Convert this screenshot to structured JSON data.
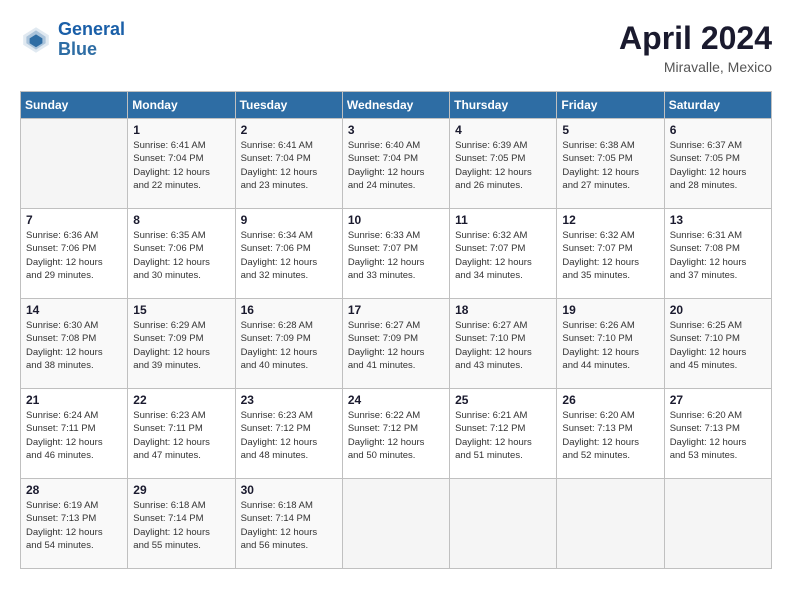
{
  "header": {
    "logo_line1": "General",
    "logo_line2": "Blue",
    "month_year": "April 2024",
    "location": "Miravalle, Mexico"
  },
  "days_of_week": [
    "Sunday",
    "Monday",
    "Tuesday",
    "Wednesday",
    "Thursday",
    "Friday",
    "Saturday"
  ],
  "weeks": [
    [
      {
        "day": "",
        "info": ""
      },
      {
        "day": "1",
        "info": "Sunrise: 6:41 AM\nSunset: 7:04 PM\nDaylight: 12 hours\nand 22 minutes."
      },
      {
        "day": "2",
        "info": "Sunrise: 6:41 AM\nSunset: 7:04 PM\nDaylight: 12 hours\nand 23 minutes."
      },
      {
        "day": "3",
        "info": "Sunrise: 6:40 AM\nSunset: 7:04 PM\nDaylight: 12 hours\nand 24 minutes."
      },
      {
        "day": "4",
        "info": "Sunrise: 6:39 AM\nSunset: 7:05 PM\nDaylight: 12 hours\nand 26 minutes."
      },
      {
        "day": "5",
        "info": "Sunrise: 6:38 AM\nSunset: 7:05 PM\nDaylight: 12 hours\nand 27 minutes."
      },
      {
        "day": "6",
        "info": "Sunrise: 6:37 AM\nSunset: 7:05 PM\nDaylight: 12 hours\nand 28 minutes."
      }
    ],
    [
      {
        "day": "7",
        "info": "Sunrise: 6:36 AM\nSunset: 7:06 PM\nDaylight: 12 hours\nand 29 minutes."
      },
      {
        "day": "8",
        "info": "Sunrise: 6:35 AM\nSunset: 7:06 PM\nDaylight: 12 hours\nand 30 minutes."
      },
      {
        "day": "9",
        "info": "Sunrise: 6:34 AM\nSunset: 7:06 PM\nDaylight: 12 hours\nand 32 minutes."
      },
      {
        "day": "10",
        "info": "Sunrise: 6:33 AM\nSunset: 7:07 PM\nDaylight: 12 hours\nand 33 minutes."
      },
      {
        "day": "11",
        "info": "Sunrise: 6:32 AM\nSunset: 7:07 PM\nDaylight: 12 hours\nand 34 minutes."
      },
      {
        "day": "12",
        "info": "Sunrise: 6:32 AM\nSunset: 7:07 PM\nDaylight: 12 hours\nand 35 minutes."
      },
      {
        "day": "13",
        "info": "Sunrise: 6:31 AM\nSunset: 7:08 PM\nDaylight: 12 hours\nand 37 minutes."
      }
    ],
    [
      {
        "day": "14",
        "info": "Sunrise: 6:30 AM\nSunset: 7:08 PM\nDaylight: 12 hours\nand 38 minutes."
      },
      {
        "day": "15",
        "info": "Sunrise: 6:29 AM\nSunset: 7:09 PM\nDaylight: 12 hours\nand 39 minutes."
      },
      {
        "day": "16",
        "info": "Sunrise: 6:28 AM\nSunset: 7:09 PM\nDaylight: 12 hours\nand 40 minutes."
      },
      {
        "day": "17",
        "info": "Sunrise: 6:27 AM\nSunset: 7:09 PM\nDaylight: 12 hours\nand 41 minutes."
      },
      {
        "day": "18",
        "info": "Sunrise: 6:27 AM\nSunset: 7:10 PM\nDaylight: 12 hours\nand 43 minutes."
      },
      {
        "day": "19",
        "info": "Sunrise: 6:26 AM\nSunset: 7:10 PM\nDaylight: 12 hours\nand 44 minutes."
      },
      {
        "day": "20",
        "info": "Sunrise: 6:25 AM\nSunset: 7:10 PM\nDaylight: 12 hours\nand 45 minutes."
      }
    ],
    [
      {
        "day": "21",
        "info": "Sunrise: 6:24 AM\nSunset: 7:11 PM\nDaylight: 12 hours\nand 46 minutes."
      },
      {
        "day": "22",
        "info": "Sunrise: 6:23 AM\nSunset: 7:11 PM\nDaylight: 12 hours\nand 47 minutes."
      },
      {
        "day": "23",
        "info": "Sunrise: 6:23 AM\nSunset: 7:12 PM\nDaylight: 12 hours\nand 48 minutes."
      },
      {
        "day": "24",
        "info": "Sunrise: 6:22 AM\nSunset: 7:12 PM\nDaylight: 12 hours\nand 50 minutes."
      },
      {
        "day": "25",
        "info": "Sunrise: 6:21 AM\nSunset: 7:12 PM\nDaylight: 12 hours\nand 51 minutes."
      },
      {
        "day": "26",
        "info": "Sunrise: 6:20 AM\nSunset: 7:13 PM\nDaylight: 12 hours\nand 52 minutes."
      },
      {
        "day": "27",
        "info": "Sunrise: 6:20 AM\nSunset: 7:13 PM\nDaylight: 12 hours\nand 53 minutes."
      }
    ],
    [
      {
        "day": "28",
        "info": "Sunrise: 6:19 AM\nSunset: 7:13 PM\nDaylight: 12 hours\nand 54 minutes."
      },
      {
        "day": "29",
        "info": "Sunrise: 6:18 AM\nSunset: 7:14 PM\nDaylight: 12 hours\nand 55 minutes."
      },
      {
        "day": "30",
        "info": "Sunrise: 6:18 AM\nSunset: 7:14 PM\nDaylight: 12 hours\nand 56 minutes."
      },
      {
        "day": "",
        "info": ""
      },
      {
        "day": "",
        "info": ""
      },
      {
        "day": "",
        "info": ""
      },
      {
        "day": "",
        "info": ""
      }
    ]
  ]
}
